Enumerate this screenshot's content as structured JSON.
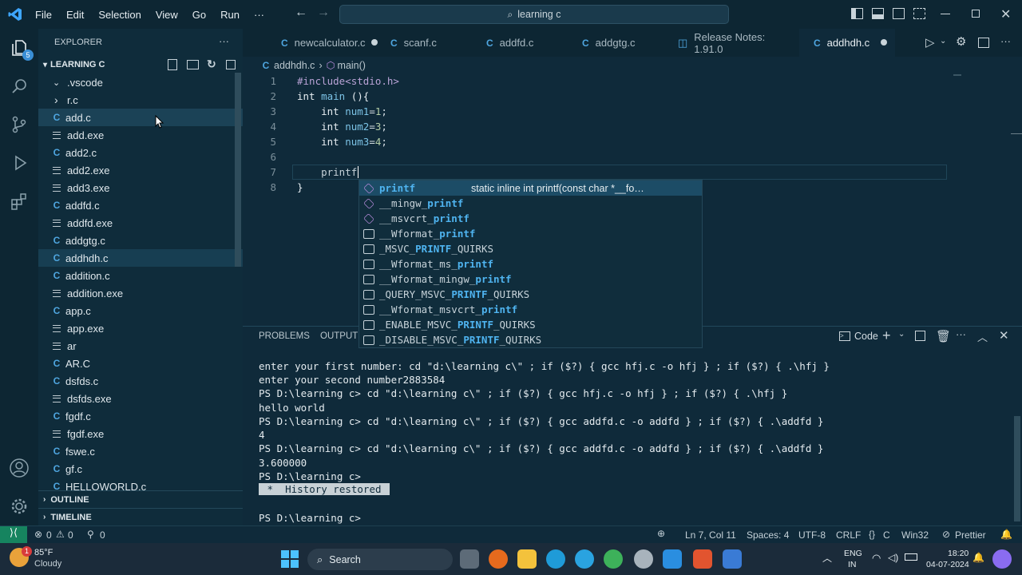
{
  "menu": {
    "items": [
      "File",
      "Edit",
      "Selection",
      "View",
      "Go",
      "Run"
    ],
    "more": "···"
  },
  "search": {
    "text": "learning c"
  },
  "activity": {
    "badge": "5"
  },
  "explorer": {
    "title": "EXPLORER",
    "more": "···",
    "folder": "LEARNING C",
    "items": [
      {
        "label": ".vscode",
        "type": "folder-open"
      },
      {
        "label": "r.c",
        "type": "folder"
      },
      {
        "label": "add.c",
        "type": "c",
        "selected": true
      },
      {
        "label": "add.exe",
        "type": "exe"
      },
      {
        "label": "add2.c",
        "type": "c"
      },
      {
        "label": "add2.exe",
        "type": "exe"
      },
      {
        "label": "add3.exe",
        "type": "exe"
      },
      {
        "label": "addfd.c",
        "type": "c"
      },
      {
        "label": "addfd.exe",
        "type": "exe"
      },
      {
        "label": "addgtg.c",
        "type": "c"
      },
      {
        "label": "addhdh.c",
        "type": "c",
        "selected": true
      },
      {
        "label": "addition.c",
        "type": "c"
      },
      {
        "label": "addition.exe",
        "type": "exe"
      },
      {
        "label": "app.c",
        "type": "c"
      },
      {
        "label": "app.exe",
        "type": "exe"
      },
      {
        "label": "ar",
        "type": "exe"
      },
      {
        "label": "AR.C",
        "type": "c"
      },
      {
        "label": "dsfds.c",
        "type": "c"
      },
      {
        "label": "dsfds.exe",
        "type": "exe"
      },
      {
        "label": "fgdf.c",
        "type": "c"
      },
      {
        "label": "fgdf.exe",
        "type": "exe"
      },
      {
        "label": "fswe.c",
        "type": "c"
      },
      {
        "label": "gf.c",
        "type": "c"
      },
      {
        "label": "HELLOWORLD.c",
        "type": "c"
      }
    ],
    "outline": "OUTLINE",
    "timeline": "TIMELINE"
  },
  "tabs": [
    {
      "label": "newcalculator.c",
      "icon": "C",
      "dirty": true
    },
    {
      "label": "scanf.c",
      "icon": "C"
    },
    {
      "label": "addfd.c",
      "icon": "C"
    },
    {
      "label": "addgtg.c",
      "icon": "C"
    },
    {
      "label": "Release Notes: 1.91.0",
      "icon": "release-notes-icon"
    },
    {
      "label": "addhdh.c",
      "icon": "C",
      "active": true,
      "dirty": true
    }
  ],
  "breadcrumb": {
    "file": "addhdh.c",
    "symbol": "main()"
  },
  "code": {
    "line_numbers": [
      "1",
      "2",
      "3",
      "4",
      "5",
      "6",
      "7",
      "8"
    ],
    "l1": "#include<stdio.h>",
    "l2a": "int",
    " l2b": "main",
    "l2c": " (){",
    "l3a": "int",
    "l3b": "num1",
    "l3c": "=",
    "l3d": "1",
    "l3e": ";",
    "l4a": "int",
    "l4b": "num2",
    "l4c": "=",
    "l4d": "3",
    "l4e": ";",
    "l5a": "int",
    "l5b": "num3",
    "l5c": "=",
    "l5d": "4",
    "l5e": ";",
    "l7": "printf",
    "l8": "}"
  },
  "suggest": {
    "detail": "static inline int printf(const char *__fo…",
    "items": [
      {
        "pre": "",
        "match": "printf",
        "post": "",
        "kind": "method"
      },
      {
        "pre": "__mingw_",
        "match": "printf",
        "post": "",
        "kind": "method"
      },
      {
        "pre": "__msvcrt_",
        "match": "printf",
        "post": "",
        "kind": "method"
      },
      {
        "pre": "__Wformat_",
        "match": "printf",
        "post": "",
        "kind": "text"
      },
      {
        "pre": "_MSVC_",
        "match": "PRINTF",
        "post": "_QUIRKS",
        "kind": "text"
      },
      {
        "pre": "__Wformat_ms_",
        "match": "printf",
        "post": "",
        "kind": "text"
      },
      {
        "pre": "__Wformat_mingw_",
        "match": "printf",
        "post": "",
        "kind": "text"
      },
      {
        "pre": "_QUERY_MSVC_",
        "match": "PRINTF",
        "post": "_QUIRKS",
        "kind": "text"
      },
      {
        "pre": "__Wformat_msvcrt_",
        "match": "printf",
        "post": "",
        "kind": "text"
      },
      {
        "pre": "_ENABLE_MSVC_",
        "match": "PRINTF",
        "post": "_QUIRKS",
        "kind": "text"
      },
      {
        "pre": "_DISABLE_MSVC_",
        "match": "PRINTF",
        "post": "_QUIRKS",
        "kind": "text"
      }
    ]
  },
  "panel": {
    "tabs": [
      "PROBLEMS",
      "OUTPUT"
    ],
    "terminal_name": "Code",
    "lines": [
      "enter your first number: cd \"d:\\learning c\\\" ; if ($?) { gcc hfj.c -o hfj } ; if ($?) { .\\hfj }",
      "enter your second number2883584",
      "PS D:\\learning c> cd \"d:\\learning c\\\" ; if ($?) { gcc hfj.c -o hfj } ; if ($?) { .\\hfj }",
      "hello world",
      "PS D:\\learning c> cd \"d:\\learning c\\\" ; if ($?) { gcc addfd.c -o addfd } ; if ($?) { .\\addfd }",
      "4",
      "PS D:\\learning c> cd \"d:\\learning c\\\" ; if ($?) { gcc addfd.c -o addfd } ; if ($?) { .\\addfd }",
      "3.600000",
      "PS D:\\learning c>"
    ],
    "history": " *  History restored ",
    "prompt": "PS D:\\learning c>"
  },
  "status": {
    "errors": "0",
    "warnings": "0",
    "ports": "0",
    "position": "Ln 7, Col 11",
    "spaces": "Spaces: 4",
    "encoding": "UTF-8",
    "eol": "CRLF",
    "lang": "C",
    "platform": "Win32",
    "prettier": "Prettier"
  },
  "taskbar": {
    "temp": "85°F",
    "weather": "Cloudy",
    "weather_badge": "1",
    "search": "Search",
    "lang1": "ENG",
    "lang2": "IN",
    "time": "18:20",
    "date": "04-07-2024"
  }
}
